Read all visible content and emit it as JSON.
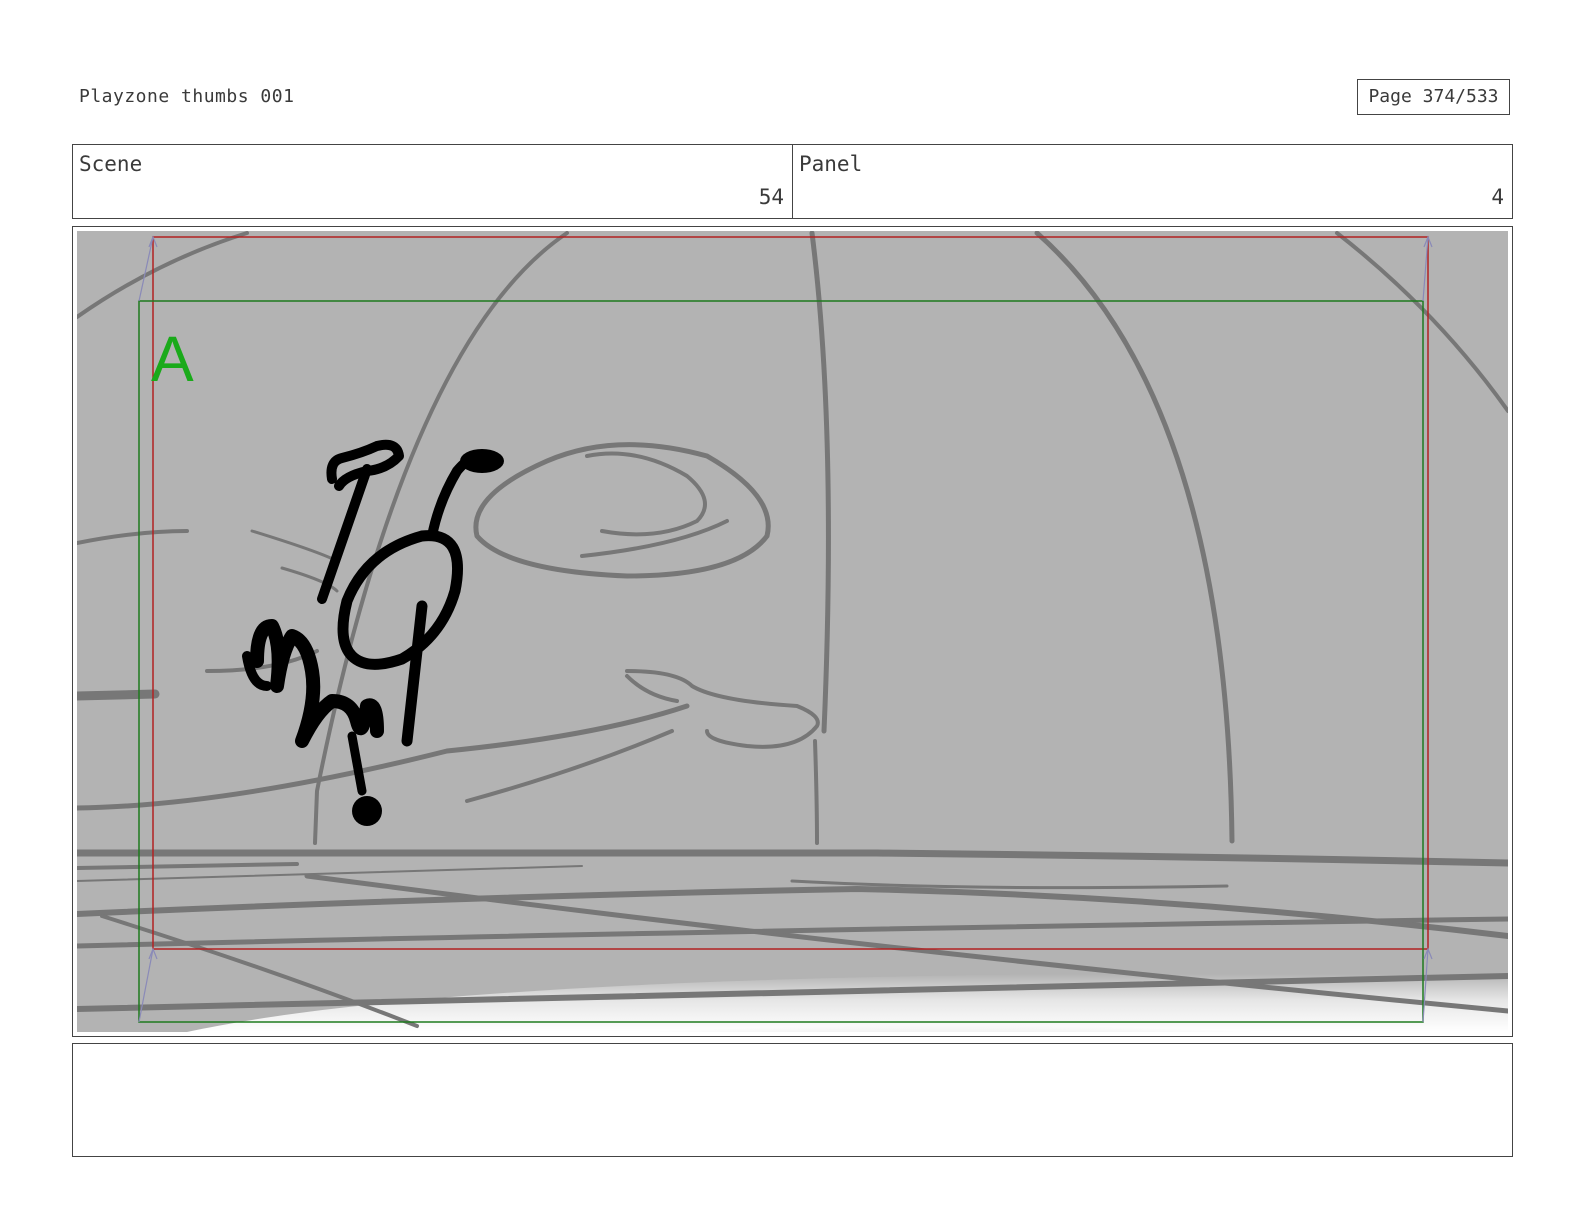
{
  "document": {
    "title": "Playzone thumbs 001",
    "page_label": "Page 374/533"
  },
  "panel_info": {
    "scene_label": "Scene",
    "scene_number": "54",
    "panel_label": "Panel",
    "panel_number": "4"
  },
  "frame": {
    "safe_area_marker": "A",
    "colors": {
      "background": "#b3b3b3",
      "sketch_lines": "#777777",
      "character_ink": "#000000",
      "red_frame": "#b22222",
      "green_frame": "#1e7a1e",
      "marker": "#1aaa1a"
    }
  },
  "notes": {
    "text": ""
  }
}
